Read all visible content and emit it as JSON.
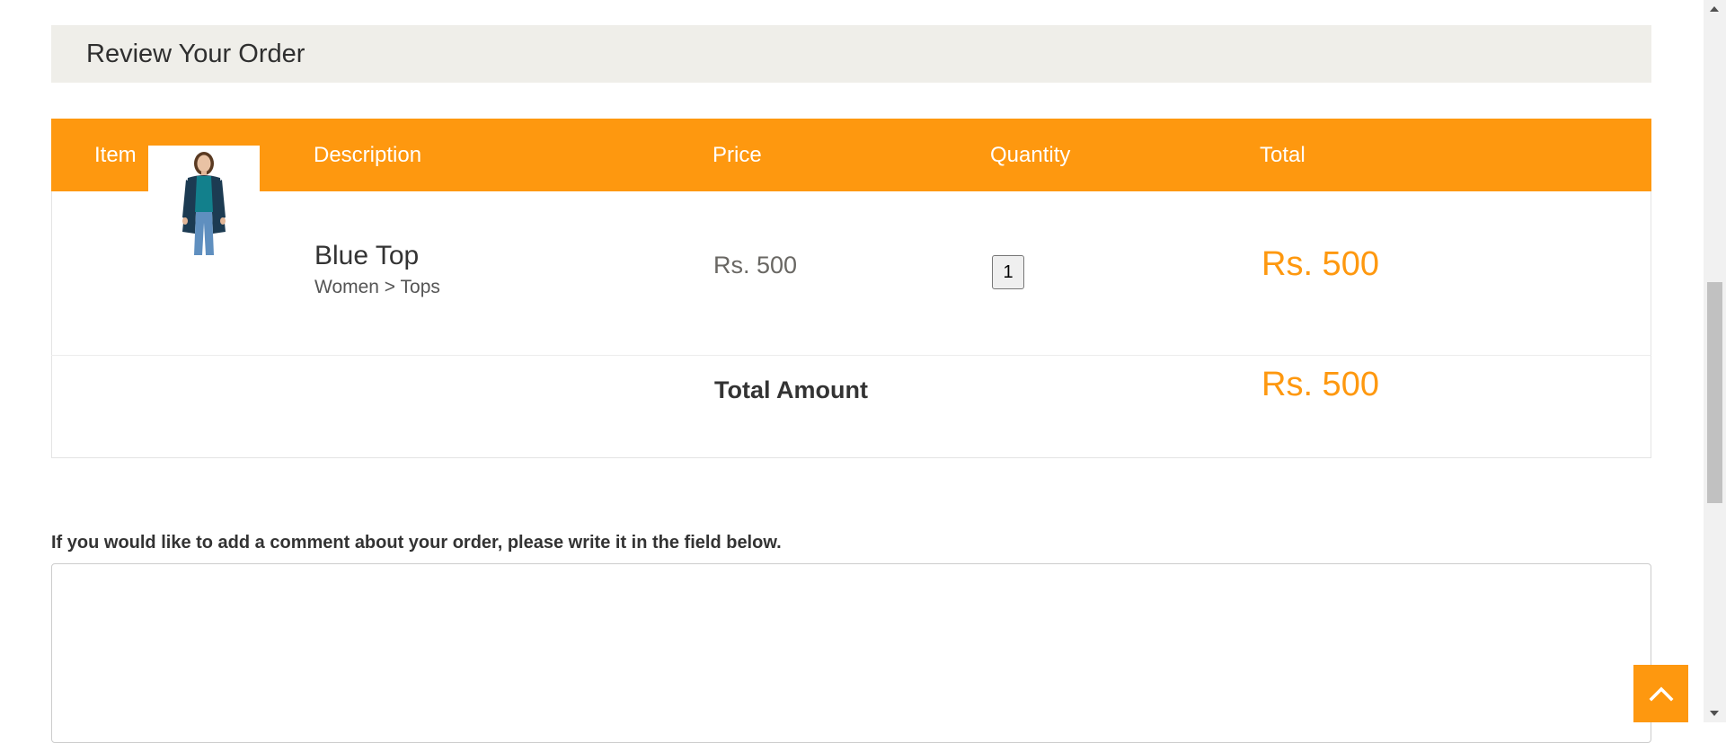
{
  "review": {
    "heading": "Review Your Order"
  },
  "table": {
    "headers": [
      "Item",
      "Description",
      "Price",
      "Quantity",
      "Total"
    ],
    "product": {
      "name": "Blue Top",
      "category": "Women > Tops",
      "price": "Rs. 500",
      "quantity": "1",
      "total": "Rs. 500"
    },
    "total_label": "Total Amount",
    "total_value": "Rs. 500"
  },
  "comment": {
    "label": "If you would like to add a comment about your order, please write it in the field below.",
    "value": ""
  },
  "colors": {
    "accent": "#fe980f",
    "heading_bg": "#efeee9"
  },
  "icons": {
    "scroll_top": "chevron-up-icon"
  }
}
